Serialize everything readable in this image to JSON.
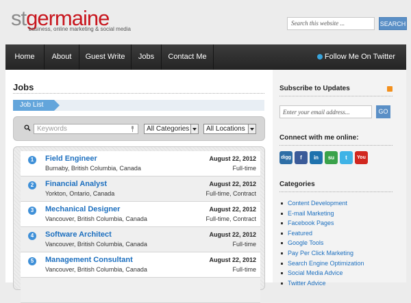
{
  "header": {
    "logo_part1": "st",
    "logo_part2": "germaine",
    "tagline": "business, online marketing & social media",
    "search_placeholder": "Search this website ...",
    "search_button": "SEARCH"
  },
  "nav": {
    "items": [
      "Home",
      "About",
      "Guest Write",
      "Jobs",
      "Contact Me"
    ],
    "follow": "Follow Me On Twitter"
  },
  "main": {
    "title": "Jobs",
    "tab_label": "Job List",
    "filter": {
      "keywords_placeholder": "Keywords",
      "categories": "All Categories",
      "locations": "All Locations"
    },
    "jobs": [
      {
        "num": "1",
        "title": "Field Engineer",
        "location": "Burnaby, British Columbia, Canada",
        "date": "August 22, 2012",
        "type": "Full-time"
      },
      {
        "num": "2",
        "title": "Financial Analyst",
        "location": "Yorkton, Ontario, Canada",
        "date": "August 22, 2012",
        "type": "Full-time, Contract"
      },
      {
        "num": "3",
        "title": "Mechanical Designer",
        "location": "Vancouver, British Columbia, Canada",
        "date": "August 22, 2012",
        "type": "Full-time, Contract"
      },
      {
        "num": "4",
        "title": "Software Architect",
        "location": "Vancouver, British Columbia, Canada",
        "date": "August 22, 2012",
        "type": "Full-time"
      },
      {
        "num": "5",
        "title": "Management Consultant",
        "location": "Vancouver, British Columbia, Canada",
        "date": "August 22, 2012",
        "type": "Full-time"
      }
    ]
  },
  "sidebar": {
    "subscribe_title": "Subscribe to Updates",
    "email_placeholder": "Enter your email address...",
    "go_button": "GO",
    "connect_title": "Connect with me online:",
    "social": [
      {
        "icon": "digg-icon",
        "label": "digg",
        "color": "#2e6ea6"
      },
      {
        "icon": "facebook-icon",
        "label": "f",
        "color": "#3b5b99"
      },
      {
        "icon": "linkedin-icon",
        "label": "in",
        "color": "#1f72ad"
      },
      {
        "icon": "stumbleupon-icon",
        "label": "su",
        "color": "#3aa24a"
      },
      {
        "icon": "twitter-icon",
        "label": "t",
        "color": "#3fb3e6"
      },
      {
        "icon": "youtube-icon",
        "label": "You",
        "color": "#d1271f"
      }
    ],
    "categories_title": "Categories",
    "categories": [
      "Content Development",
      "E-mail Marketing",
      "Facebook Pages",
      "Featured",
      "Google Tools",
      "Pay Per Click Marketing",
      "Search Engine Optimization",
      "Social Media Advice",
      "Twitter Advice"
    ]
  },
  "colors": {
    "brand_red": "#c8151d",
    "link_blue": "#1c6fbf",
    "button_blue": "#5a8fc6",
    "nav_dark": "#2e2e2e"
  }
}
